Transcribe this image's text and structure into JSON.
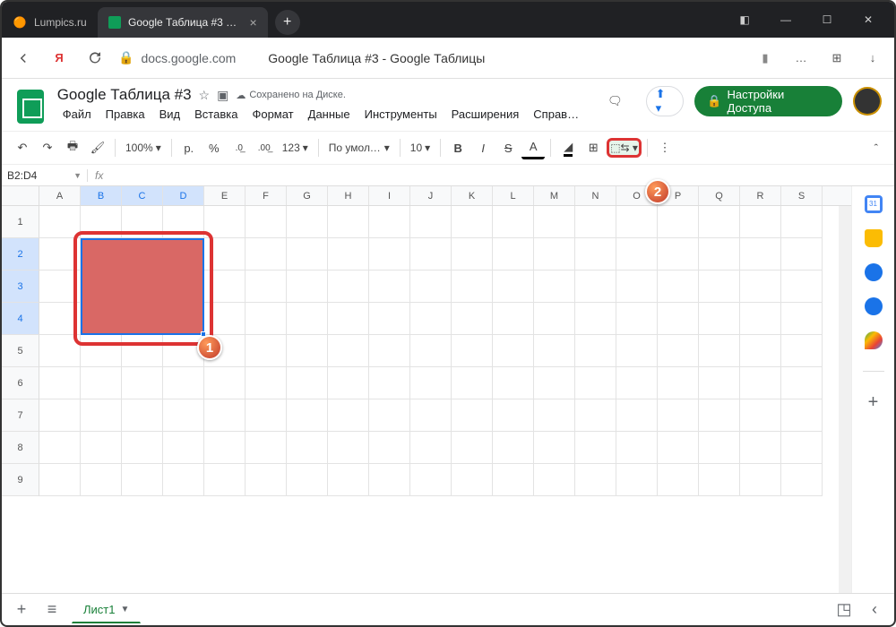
{
  "browser": {
    "tabs": [
      {
        "title": "Lumpics.ru",
        "active": false
      },
      {
        "title": "Google Таблица #3 - G…",
        "active": true
      }
    ],
    "url_host": "docs.google.com",
    "page_title": "Google Таблица #3 - Google Таблицы"
  },
  "doc": {
    "title": "Google Таблица #3",
    "saved_text": "Сохранено на Диске.",
    "menus": [
      "Файл",
      "Правка",
      "Вид",
      "Вставка",
      "Формат",
      "Данные",
      "Инструменты",
      "Расширения",
      "Справ…"
    ],
    "share_label": "Настройки Доступа"
  },
  "toolbar": {
    "zoom": "100%",
    "currency": "р.",
    "percent": "%",
    "dec_dec": ".0",
    "inc_dec": ".00",
    "format_more": "123",
    "font": "По умолча...",
    "font_size": "10",
    "bold": "B",
    "italic": "I",
    "strike": "S",
    "text_color": "A"
  },
  "callouts": {
    "one": "1",
    "two": "2"
  },
  "namebox": {
    "range": "B2:D4",
    "fx": "fx"
  },
  "columns": [
    "A",
    "B",
    "C",
    "D",
    "E",
    "F",
    "G",
    "H",
    "I",
    "J",
    "K",
    "L",
    "M",
    "N",
    "O",
    "P",
    "Q",
    "R",
    "S"
  ],
  "selected_cols": [
    "B",
    "C",
    "D"
  ],
  "rows": [
    1,
    2,
    3,
    4,
    5,
    6,
    7,
    8,
    9
  ],
  "selected_rows": [
    2,
    3,
    4
  ],
  "sheet_tab": "Лист1",
  "side_icons": [
    {
      "name": "calendar",
      "color": "#4285f4"
    },
    {
      "name": "keep",
      "color": "#fbbc04"
    },
    {
      "name": "tasks",
      "color": "#1a73e8"
    },
    {
      "name": "contacts",
      "color": "#1a73e8"
    },
    {
      "name": "maps",
      "color": "#34a853"
    }
  ]
}
